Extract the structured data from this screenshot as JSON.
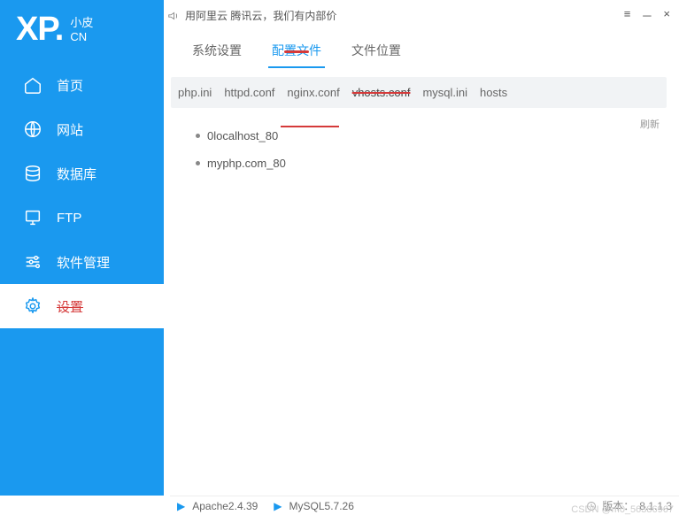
{
  "logo": {
    "main": "XP.",
    "sub1": "小皮",
    "sub2": "CN"
  },
  "titlebar": {
    "announce": "用阿里云 腾讯云，我们有内部价"
  },
  "win": {
    "menu": "≡",
    "min": "－",
    "close": "×"
  },
  "sidebar": {
    "items": [
      {
        "label": "首页"
      },
      {
        "label": "网站"
      },
      {
        "label": "数据库"
      },
      {
        "label": "FTP"
      },
      {
        "label": "软件管理"
      },
      {
        "label": "设置"
      }
    ]
  },
  "tabs": [
    {
      "label": "系统设置"
    },
    {
      "label": "配置文件"
    },
    {
      "label": "文件位置"
    }
  ],
  "subtabs": [
    {
      "label": "php.ini"
    },
    {
      "label": "httpd.conf"
    },
    {
      "label": "nginx.conf"
    },
    {
      "label": "vhosts.conf"
    },
    {
      "label": "mysql.ini"
    },
    {
      "label": "hosts"
    }
  ],
  "hosts": [
    {
      "label": "0localhost_80"
    },
    {
      "label": "myphp.com_80"
    }
  ],
  "refresh": "刷新",
  "status": {
    "apache": "Apache2.4.39",
    "mysql": "MySQL5.7.26",
    "version_label": "版本：",
    "version": "8.1.1.3"
  },
  "watermark": "CSDN @m0_56386967"
}
